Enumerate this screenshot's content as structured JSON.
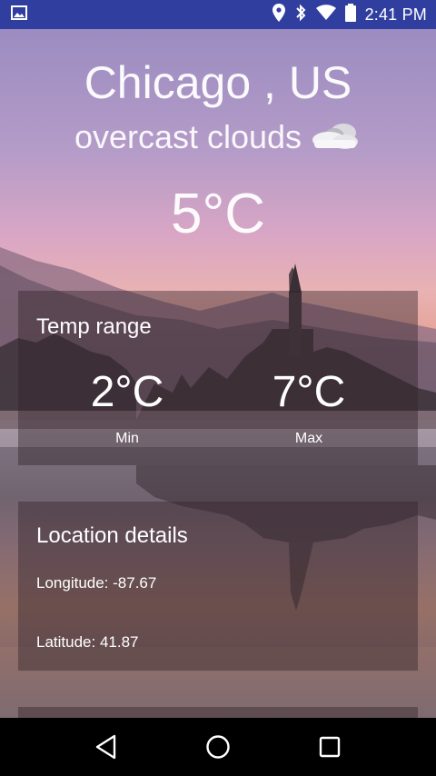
{
  "status_bar": {
    "time": "2:41 PM",
    "icons": [
      "image-icon",
      "location-icon",
      "bluetooth-icon",
      "wifi-icon",
      "battery-icon"
    ]
  },
  "weather": {
    "city": "Chicago , US",
    "description": "overcast clouds",
    "condition_icon": "cloud-icon",
    "temperature": "5°C"
  },
  "temp_range": {
    "title": "Temp range",
    "min_value": "2°C",
    "min_label": "Min",
    "max_value": "7°C",
    "max_label": "Max"
  },
  "location": {
    "title": "Location details",
    "longitude": "Longitude: -87.67",
    "latitude": "Latitude: 41.87"
  },
  "nav": {
    "icons": [
      "back-icon",
      "home-icon",
      "recents-icon"
    ]
  },
  "colors": {
    "status_bar": "#303f9f",
    "card_bg": "rgba(48,34,40,0.42)",
    "text": "#ffffff"
  }
}
